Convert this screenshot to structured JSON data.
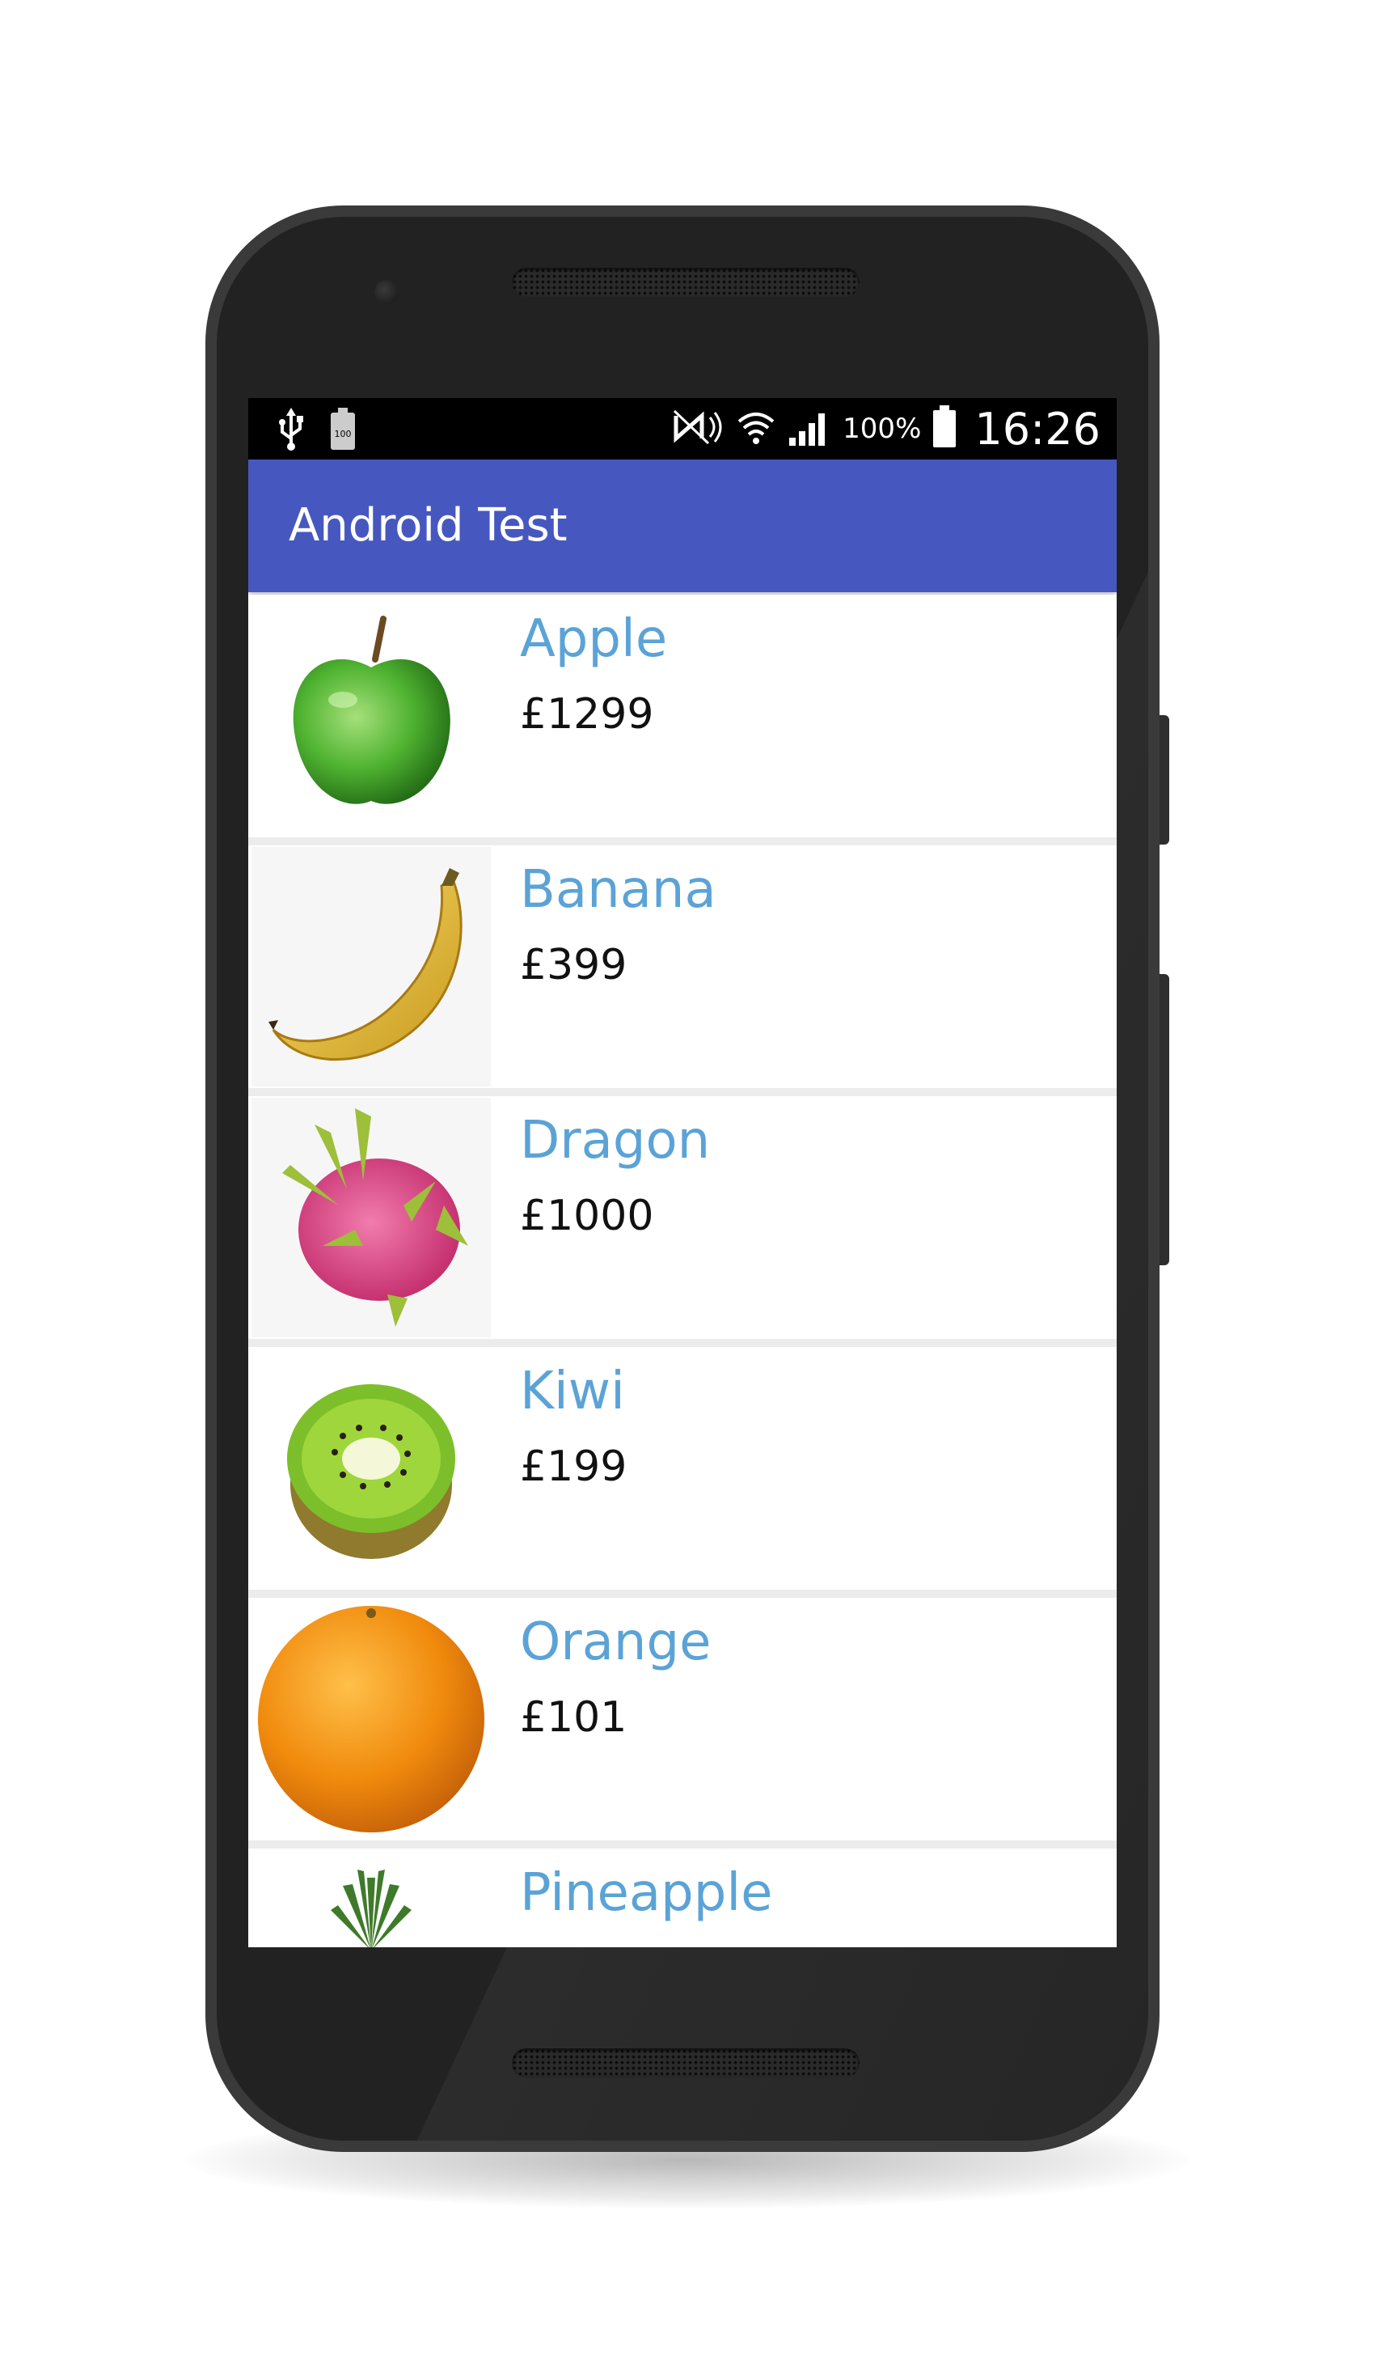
{
  "status_bar": {
    "left_icons": [
      "usb-icon",
      "battery-100-icon"
    ],
    "right_icons": [
      "nfc-icon",
      "wifi-icon",
      "signal-icon",
      "battery-icon"
    ],
    "battery_percent": "100%",
    "time": "16:26"
  },
  "app_bar": {
    "title": "Android Test",
    "color": "#4658bf"
  },
  "list": {
    "items": [
      {
        "name": "Apple",
        "price": "£1299",
        "icon": "apple-icon"
      },
      {
        "name": "Banana",
        "price": "£399",
        "icon": "banana-icon"
      },
      {
        "name": "Dragon",
        "price": "£1000",
        "icon": "dragon-fruit-icon"
      },
      {
        "name": "Kiwi",
        "price": "£199",
        "icon": "kiwi-icon"
      },
      {
        "name": "Orange",
        "price": "£101",
        "icon": "orange-icon"
      },
      {
        "name": "Pineapple",
        "price": "",
        "icon": "pineapple-icon"
      }
    ],
    "name_color": "#5ba3d6"
  }
}
